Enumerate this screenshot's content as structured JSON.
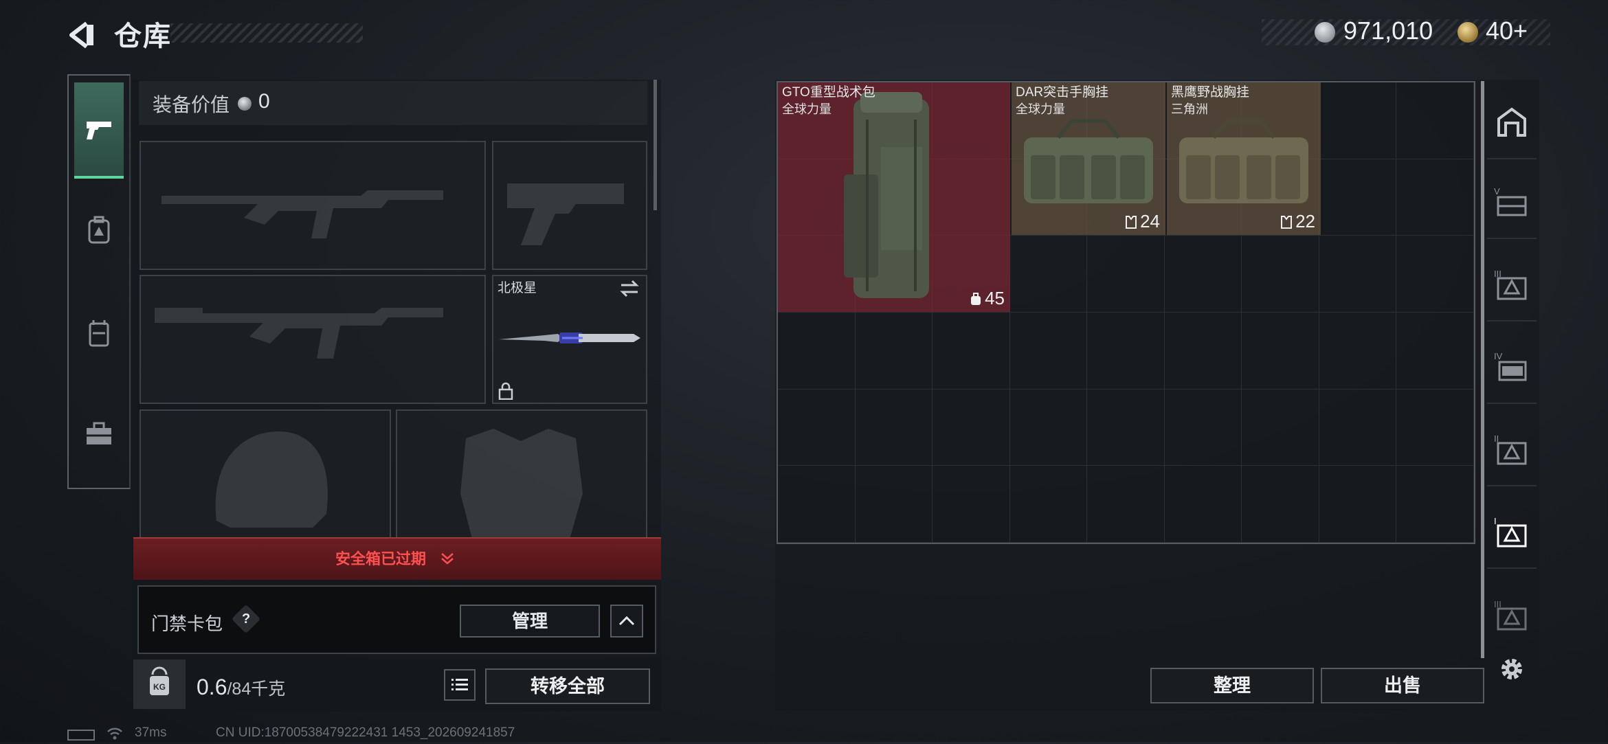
{
  "header": {
    "title": "仓库",
    "coins": "971,010",
    "tickets": "40+"
  },
  "left_tabs": [
    {
      "id": "weapons",
      "icon": "pistol-icon",
      "active": true
    },
    {
      "id": "backpack",
      "icon": "backpack-icon",
      "active": false
    },
    {
      "id": "vest",
      "icon": "vest-icon",
      "active": false
    },
    {
      "id": "toolbox",
      "icon": "toolbox-icon",
      "active": false
    }
  ],
  "equipment": {
    "value_label": "装备价值",
    "value": "0",
    "melee_name": "北极星"
  },
  "safe_banner": "安全箱已过期",
  "keycard": {
    "label": "门禁卡包",
    "help": "?",
    "manage": "管理"
  },
  "capacity": {
    "current": "0.6",
    "max": "/84千克"
  },
  "actions": {
    "transfer_all": "转移全部",
    "sort": "整理",
    "sell": "出售"
  },
  "storage_items": [
    {
      "name": "GTO重型战术包",
      "source": "全球力量",
      "capacity": "45",
      "rarity_color": "#76263a"
    },
    {
      "name": "DAR突击手胸挂",
      "source": "全球力量",
      "capacity": "24",
      "rarity_color": "#60503c"
    },
    {
      "name": "黑鹰野战胸挂",
      "source": "三角洲",
      "capacity": "22",
      "rarity_color": "#60503c"
    }
  ],
  "right_tabs": [
    {
      "icon": "vault-icon"
    },
    {
      "icon": "storage-v-icon"
    },
    {
      "icon": "storage-iii-icon"
    },
    {
      "icon": "storage-iv-icon"
    },
    {
      "icon": "storage-ii-icon"
    },
    {
      "icon": "storage-i-icon",
      "active": true
    },
    {
      "icon": "storage-iii-alt-icon"
    }
  ],
  "status": {
    "ping": "37ms",
    "uid": "CN UID:18700538479222431 1453_202609241857"
  }
}
